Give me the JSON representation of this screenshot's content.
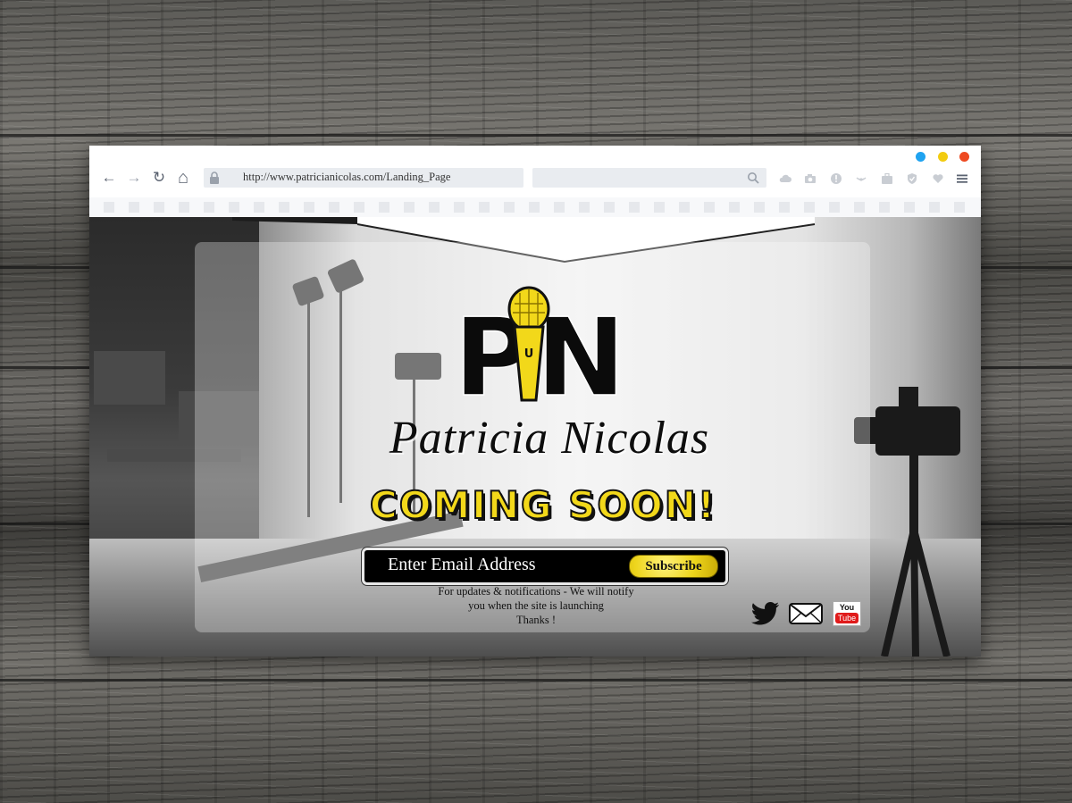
{
  "browser": {
    "url": "http://www.patricianicolas.com/Landing_Page",
    "nav": {
      "back_icon": "←",
      "forward_icon": "→",
      "reload_icon": "↻",
      "home_icon": "⌂"
    },
    "window_dots": [
      "#1fa3f0",
      "#f2cc10",
      "#ee4a21"
    ],
    "toolbar_icons": [
      "cloud-icon",
      "camera-icon",
      "alert-icon",
      "broadcast-icon",
      "briefcase-icon",
      "shield-icon",
      "heart-icon",
      "menu-icon"
    ]
  },
  "page": {
    "logo_letters": {
      "left": "P",
      "right": "N",
      "mic_letter": "U"
    },
    "brand_name": "Patricia Nicolas",
    "headline": "COMING SOON!",
    "email_placeholder": "Enter Email Address",
    "subscribe_label": "Subscribe",
    "note_line1": "For updates & notifications - We will notify",
    "note_line2": "you when the site is launching",
    "note_line3": "Thanks !",
    "social": {
      "twitter_icon": "twitter-icon",
      "mail_icon": "mail-icon",
      "youtube_you": "You",
      "youtube_tube": "Tube"
    },
    "accent_color": "#f2d81a"
  }
}
